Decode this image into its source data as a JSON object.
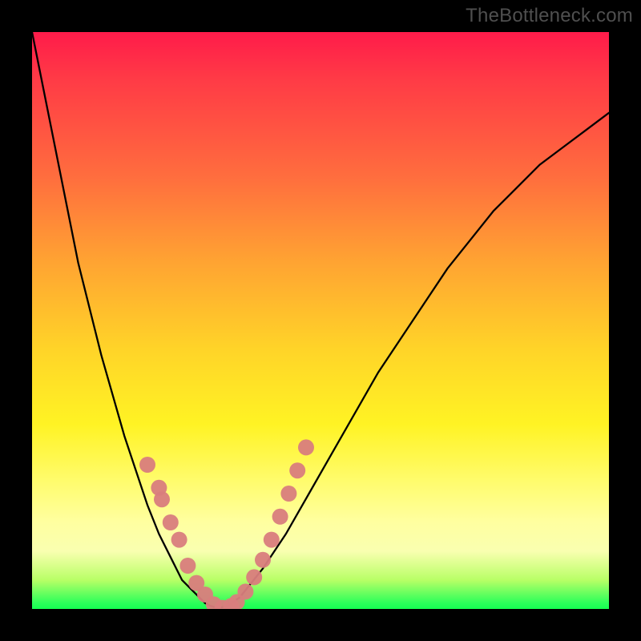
{
  "watermark": "TheBottleneck.com",
  "colors": {
    "background_black": "#000000",
    "watermark_text": "#4f4f4f",
    "curve": "#000000",
    "bead": "#d97d7d",
    "gradient_stops": [
      "#ff1b4a",
      "#ff3a46",
      "#ff6d3e",
      "#ffa432",
      "#ffd428",
      "#fff324",
      "#fffc6e",
      "#ffffa0",
      "#f9ffb0",
      "#b8ff66",
      "#2bff5a",
      "#15ff51"
    ]
  },
  "chart_data": {
    "type": "line",
    "title": "",
    "xlabel": "",
    "ylabel": "",
    "x": [
      0.0,
      0.02,
      0.04,
      0.06,
      0.08,
      0.1,
      0.12,
      0.14,
      0.16,
      0.18,
      0.2,
      0.22,
      0.24,
      0.26,
      0.28,
      0.3,
      0.31,
      0.32,
      0.33,
      0.34,
      0.36,
      0.4,
      0.44,
      0.48,
      0.52,
      0.56,
      0.6,
      0.64,
      0.68,
      0.72,
      0.76,
      0.8,
      0.84,
      0.88,
      0.92,
      0.96,
      1.0
    ],
    "y": [
      1.0,
      0.9,
      0.8,
      0.7,
      0.6,
      0.52,
      0.44,
      0.37,
      0.3,
      0.24,
      0.18,
      0.13,
      0.09,
      0.05,
      0.03,
      0.01,
      0.005,
      0.002,
      0.003,
      0.006,
      0.02,
      0.07,
      0.13,
      0.2,
      0.27,
      0.34,
      0.41,
      0.47,
      0.53,
      0.59,
      0.64,
      0.69,
      0.73,
      0.77,
      0.8,
      0.83,
      0.86
    ],
    "xlim": [
      0,
      1
    ],
    "ylim": [
      0,
      1
    ],
    "beads_left": [
      [
        0.2,
        0.25
      ],
      [
        0.22,
        0.21
      ],
      [
        0.225,
        0.19
      ],
      [
        0.24,
        0.15
      ],
      [
        0.255,
        0.12
      ],
      [
        0.27,
        0.075
      ],
      [
        0.285,
        0.045
      ],
      [
        0.3,
        0.025
      ],
      [
        0.315,
        0.008
      ],
      [
        0.33,
        0.002
      ]
    ],
    "beads_right": [
      [
        0.345,
        0.005
      ],
      [
        0.355,
        0.012
      ],
      [
        0.37,
        0.03
      ],
      [
        0.385,
        0.055
      ],
      [
        0.4,
        0.085
      ],
      [
        0.415,
        0.12
      ],
      [
        0.43,
        0.16
      ],
      [
        0.445,
        0.2
      ],
      [
        0.46,
        0.24
      ],
      [
        0.475,
        0.28
      ]
    ],
    "bead_radius_px": 10
  }
}
